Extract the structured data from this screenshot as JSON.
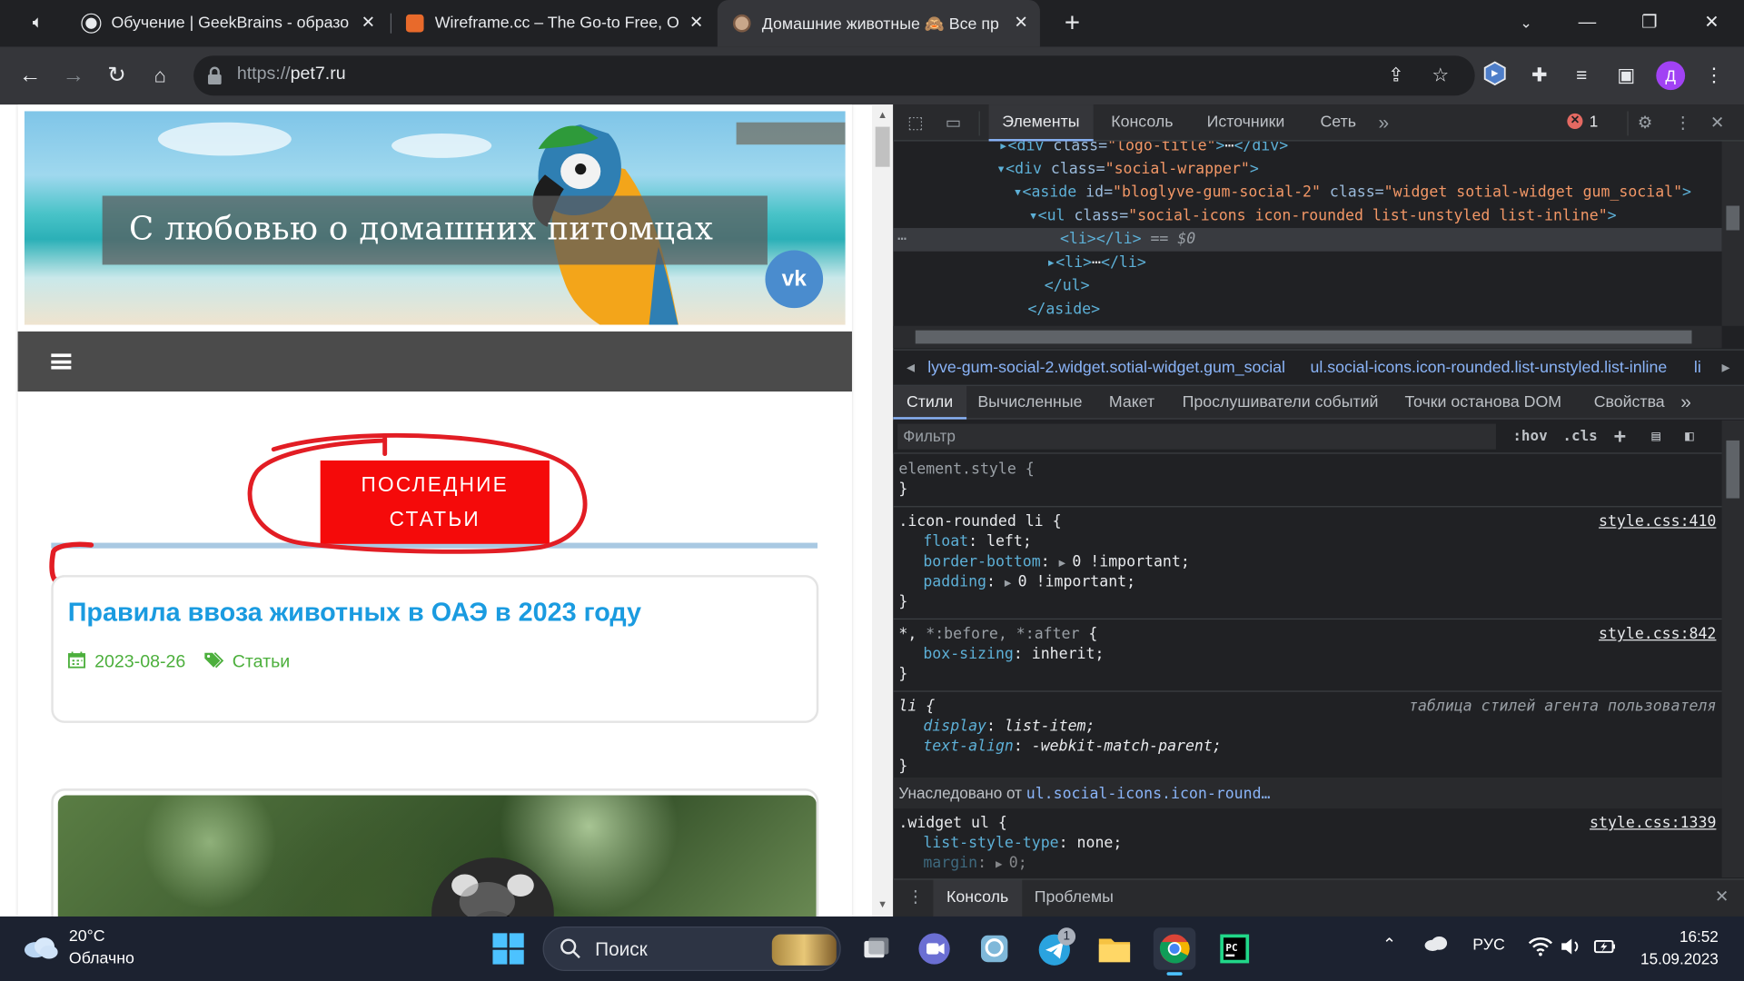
{
  "browser": {
    "tabs": [
      {
        "title": "Обучение | GeekBrains - образо",
        "active": false
      },
      {
        "title": "Wireframe.cc – The Go-to Free, O",
        "active": false
      },
      {
        "title": "Домашние животные 🙈 Все пр",
        "active": true
      }
    ],
    "new_tab": "+",
    "url_scheme": "https://",
    "url_host": "pet7.ru",
    "profile_initial": "Д"
  },
  "site": {
    "banner_text": "С любовью о домашних питомцах",
    "vk_label": "vk",
    "section_button_line1": "ПОСЛЕДНИЕ",
    "section_button_line2": "СТАТЬИ",
    "article": {
      "title": "Правила ввоза животных в ОАЭ в 2023 году",
      "date": "2023-08-26",
      "category": "Статьи"
    }
  },
  "devtools": {
    "tabs": [
      "Элементы",
      "Консоль",
      "Источники",
      "Сеть"
    ],
    "active_tab": "Элементы",
    "error_count": "1",
    "dom": {
      "line0_attr": "class=",
      "line0_val": "\"logo-title\"",
      "line1_tag_open": "<div ",
      "line1_attr": "class=",
      "line1_val": "\"social-wrapper\"",
      "line2_tag_open": "<aside ",
      "line2_attr1": "id=",
      "line2_val1": "\"bloglyve-gum-social-2\"",
      "line2_attr2": " class=",
      "line2_val2": "\"widget sotial-widget gum_social\"",
      "line3_tag_open": "<ul ",
      "line3_attr": "class=",
      "line3_val": "\"social-icons icon-rounded  list-unstyled list-inline\"",
      "line4": "<li></li>",
      "line4_suffix": " == $0",
      "line5_open": "<li>",
      "line5_close": "</li>",
      "line6": "</ul>",
      "line7": "</aside>"
    },
    "breadcrumb": [
      "lyve-gum-social-2.widget.sotial-widget.gum_social",
      "ul.social-icons.icon-rounded.list-unstyled.list-inline",
      "li"
    ],
    "subtabs": [
      "Стили",
      "Вычисленные",
      "Макет",
      "Прослушиватели событий",
      "Точки останова DOM",
      "Свойства"
    ],
    "filter_placeholder": "Фильтр",
    "hov": ":hov",
    "cls": ".cls",
    "styles": {
      "element_style": "element.style {",
      "rule1_selector": ".icon-rounded li {",
      "rule1_source": "style.css:410",
      "rule1_props": [
        {
          "name": "float",
          "value": "left;"
        },
        {
          "name": "border-bottom",
          "value": "0 !important;"
        },
        {
          "name": "padding",
          "value": "0 !important;"
        }
      ],
      "rule2_selector_a": "*,",
      "rule2_selector_b": " *:before, *:after",
      "rule2_source": "style.css:842",
      "rule2_prop": {
        "name": "box-sizing",
        "value": "inherit;"
      },
      "rule3_selector": "li {",
      "rule3_source": "таблица стилей агента пользователя",
      "rule3_props": [
        {
          "name": "display",
          "value": "list-item;"
        },
        {
          "name": "text-align",
          "value": "-webkit-match-parent;"
        }
      ],
      "inherited_label": "Унаследовано от",
      "inherited_from": "ul.social-icons.icon-round…",
      "rule4_selector": ".widget ul {",
      "rule4_source": "style.css:1339",
      "rule4_props": [
        {
          "name": "list-style-type",
          "value": "none;"
        },
        {
          "name": "margin",
          "value": "0;"
        }
      ],
      "close_brace": "}"
    },
    "drawer_tabs": [
      "Консоль",
      "Проблемы"
    ]
  },
  "taskbar": {
    "temperature": "20°C",
    "weather": "Облачно",
    "search_label": "Поиск",
    "telegram_badge": "1",
    "lang": "РУС",
    "time": "16:52",
    "date": "15.09.2023"
  },
  "colors": {
    "accent_red": "#f50a0a",
    "link_blue": "#1a9be0",
    "meta_green": "#4caf3c",
    "devtools_bg": "#202124"
  }
}
